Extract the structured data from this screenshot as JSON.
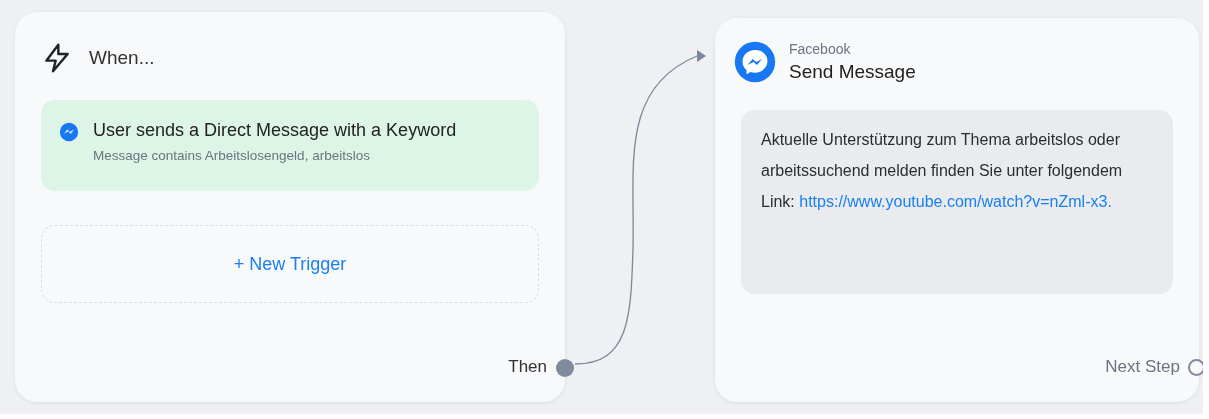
{
  "trigger_card": {
    "title": "When...",
    "triggers": [
      {
        "title": "User sends a Direct Message with a Keyword",
        "subtitle": "Message contains Arbeitslosengeld, arbeitslos"
      }
    ],
    "new_trigger": "+ New Trigger",
    "output_label": "Then"
  },
  "action_card": {
    "platform": "Facebook",
    "title": "Send Message",
    "message": {
      "text": "Aktuelle Unterstützung zum Thema arbeitslos oder arbeitssuchend melden finden Sie unter folgendem Link:",
      "link": "https://www.youtube.com/watch?v=nZml-x3."
    },
    "output_label": "Next Step"
  }
}
